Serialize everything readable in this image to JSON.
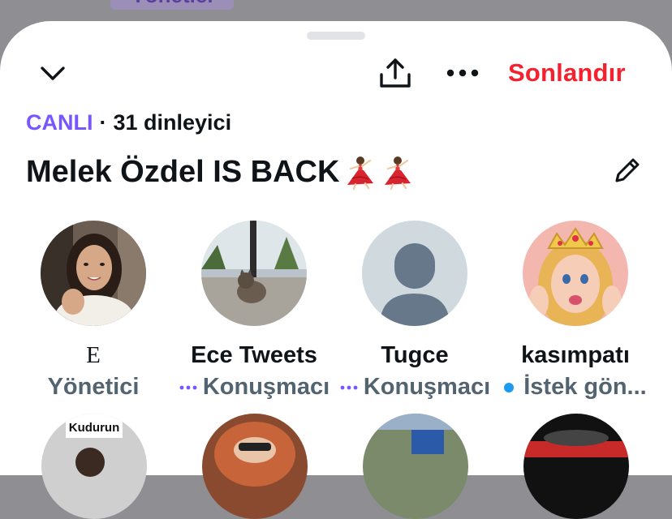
{
  "backdrop": {
    "pill_label": "Yönetici"
  },
  "header": {
    "collapse_icon": "chevron-down-icon",
    "share_icon": "share-icon",
    "more_icon": "more-horizontal-icon",
    "end_label": "Sonlandır"
  },
  "space": {
    "live_label": "CANLI",
    "separator": "·",
    "listeners": "31 dinleyici",
    "title": "Melek Özdel IS BACK",
    "title_emoji": "dancer-emoji",
    "edit_icon": "pencil-icon"
  },
  "participants": [
    {
      "name": "E",
      "role": "Yönetici",
      "indicator": "none"
    },
    {
      "name": "Ece Tweets",
      "role": "Konuşmacı",
      "indicator": "speaking-dots"
    },
    {
      "name": "Tugce",
      "role": "Konuşmacı",
      "indicator": "speaking-dots"
    },
    {
      "name": "kasımpatı",
      "role": "İstek gön...",
      "indicator": "blue-dot"
    }
  ],
  "second_row": {
    "avatar_text": "Kudurun"
  },
  "colors": {
    "live": "#7856ff",
    "end": "#f4212e",
    "role": "#536471",
    "request_dot": "#1d9bf0"
  }
}
